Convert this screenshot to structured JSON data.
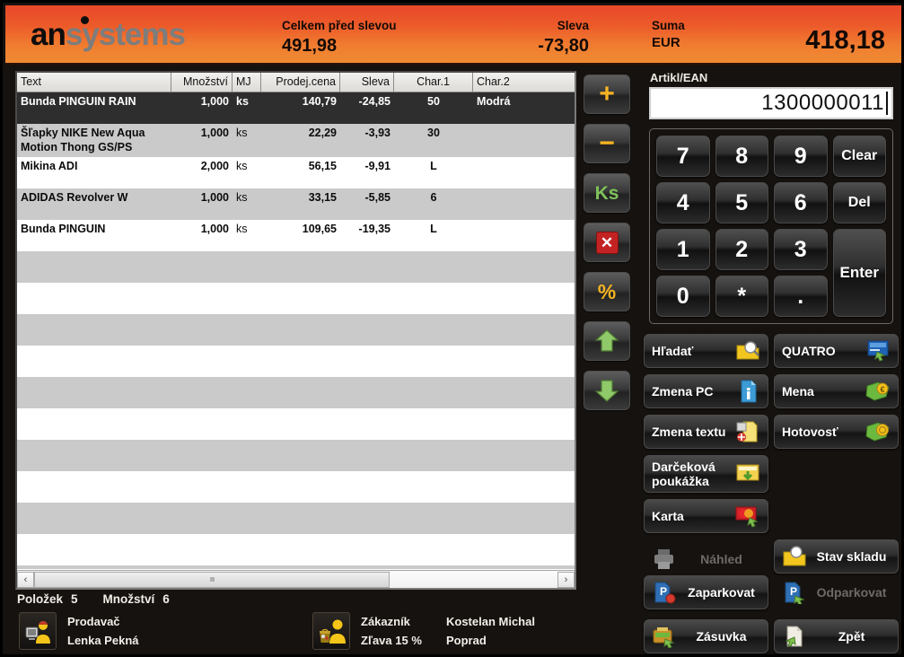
{
  "header": {
    "logo_an": "an",
    "logo_systems": "systems",
    "total_before_discount_label": "Celkem před slevou",
    "total_before_discount_value": "491,98",
    "discount_label": "Sleva",
    "discount_value": "-73,80",
    "sum_label": "Suma",
    "currency": "EUR",
    "grand_total": "418,18",
    "bg_start": "#e8482a",
    "bg_end": "#ef8b33"
  },
  "table": {
    "columns": [
      {
        "key": "text",
        "label": "Text"
      },
      {
        "key": "qty",
        "label": "Množství"
      },
      {
        "key": "mj",
        "label": "MJ"
      },
      {
        "key": "price",
        "label": "Prodej.cena"
      },
      {
        "key": "disc",
        "label": "Sleva"
      },
      {
        "key": "char1",
        "label": "Char.1"
      },
      {
        "key": "char2",
        "label": "Char.2"
      }
    ],
    "rows": [
      {
        "text": "Bunda PINGUIN RAIN",
        "qty": "1,000",
        "mj": "ks",
        "price": "140,79",
        "disc": "-24,85",
        "char1": "50",
        "char2": "Modrá",
        "selected": true
      },
      {
        "text": "Šľapky NIKE New Aqua Motion Thong GS/PS",
        "qty": "1,000",
        "mj": "ks",
        "price": "22,29",
        "disc": "-3,93",
        "char1": "30",
        "char2": "",
        "selected": false
      },
      {
        "text": "Mikina ADI",
        "qty": "2,000",
        "mj": "ks",
        "price": "56,15",
        "disc": "-9,91",
        "char1": "L",
        "char2": "",
        "selected": false
      },
      {
        "text": "ADIDAS   Revolver W",
        "qty": "1,000",
        "mj": "ks",
        "price": "33,15",
        "disc": "-5,85",
        "char1": "6",
        "char2": "",
        "selected": false
      },
      {
        "text": "Bunda PINGUIN",
        "qty": "1,000",
        "mj": "ks",
        "price": "109,65",
        "disc": "-19,35",
        "char1": "L",
        "char2": "",
        "selected": false
      }
    ],
    "empty_rows": 11,
    "scrollbar": {
      "left_arrow": "‹",
      "right_arrow": "›",
      "thumb_width_pct": 68
    }
  },
  "summary": {
    "items_label": "Položek",
    "items_value": "5",
    "quantity_label": "Množství",
    "quantity_value": "6"
  },
  "footer": {
    "seller": {
      "role": "Prodavač",
      "name": "Lenka Pekná"
    },
    "customer": {
      "role": "Zákazník",
      "name": "Kostelan Michal",
      "discount": "Zľava 15 %",
      "city": "Poprad"
    }
  },
  "toolbar": [
    {
      "name": "add",
      "glyph": "+",
      "title": "Přidat"
    },
    {
      "name": "subtract",
      "glyph": "−",
      "title": "Odebrat"
    },
    {
      "name": "quantity",
      "glyph": "Ks",
      "title": "Množství"
    },
    {
      "name": "delete",
      "glyph": "✕",
      "title": "Smazat"
    },
    {
      "name": "percent",
      "glyph": "%",
      "title": "Sleva"
    },
    {
      "name": "move-up",
      "glyph": "▲",
      "title": "Nahoru"
    },
    {
      "name": "move-down",
      "glyph": "▼",
      "title": "Dolů"
    }
  ],
  "ean": {
    "label": "Artikl/EAN",
    "value": "1300000011",
    "placeholder": ""
  },
  "keypad": [
    {
      "label": "7",
      "kind": "digit"
    },
    {
      "label": "8",
      "kind": "digit"
    },
    {
      "label": "9",
      "kind": "digit"
    },
    {
      "label": "Clear",
      "kind": "fn"
    },
    {
      "label": "4",
      "kind": "digit"
    },
    {
      "label": "5",
      "kind": "digit"
    },
    {
      "label": "6",
      "kind": "digit"
    },
    {
      "label": "Del",
      "kind": "fn"
    },
    {
      "label": "1",
      "kind": "digit"
    },
    {
      "label": "2",
      "kind": "digit"
    },
    {
      "label": "3",
      "kind": "digit"
    },
    {
      "label": "Enter",
      "kind": "enter"
    },
    {
      "label": "0",
      "kind": "digit"
    },
    {
      "label": "*",
      "kind": "digit"
    },
    {
      "label": ".",
      "kind": "digit"
    }
  ],
  "actions": {
    "search": {
      "label": "Hľadať",
      "enabled": true
    },
    "change_pc": {
      "label": "Zmena PC",
      "enabled": true
    },
    "change_text": {
      "label": "Zmena textu",
      "enabled": true
    },
    "gift_voucher": {
      "label": "Darčeková poukážka",
      "enabled": true
    },
    "card": {
      "label": "Karta",
      "enabled": true
    },
    "quatro": {
      "label": "QUATRO",
      "enabled": true
    },
    "currency": {
      "label": "Mena",
      "enabled": true
    },
    "cash": {
      "label": "Hotovosť",
      "enabled": true
    },
    "preview": {
      "label": "Náhled",
      "enabled": false
    },
    "stock_status": {
      "label": "Stav skladu",
      "enabled": true
    },
    "park": {
      "label": "Zaparkovat",
      "enabled": true
    },
    "unpark": {
      "label": "Odparkovat",
      "enabled": false
    },
    "drawer": {
      "label": "Zásuvka",
      "enabled": true
    },
    "back": {
      "label": "Zpět",
      "enabled": true
    }
  }
}
